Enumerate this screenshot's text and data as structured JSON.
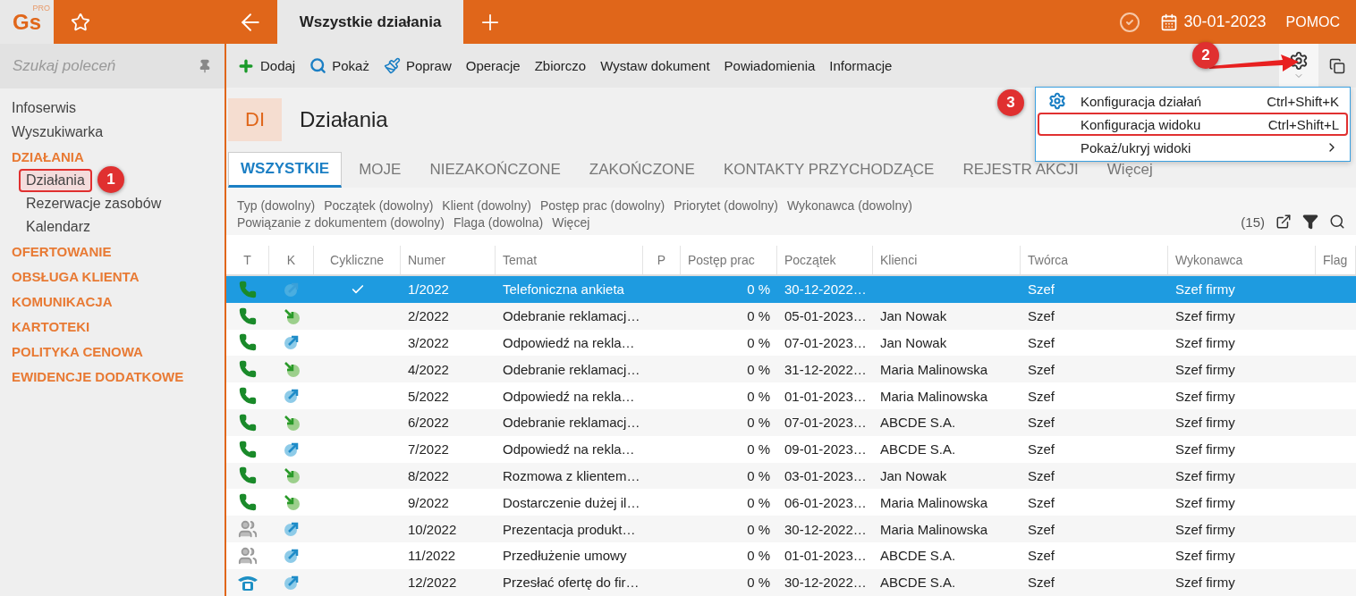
{
  "app": {
    "logo": "Gs",
    "logo_badge": "PRO",
    "tab": "Wszystkie działania",
    "date": "30-01-2023",
    "help": "POMOC"
  },
  "sidebar": {
    "search_placeholder": "Szukaj poleceń",
    "items": [
      {
        "label": "Infoserwis",
        "kind": "link"
      },
      {
        "label": "Wyszukiwarka",
        "kind": "link"
      },
      {
        "label": "DZIAŁANIA",
        "kind": "section",
        "children": [
          {
            "label": "Działania",
            "selected": true
          },
          {
            "label": "Rezerwacje zasobów",
            "selected": false
          },
          {
            "label": "Kalendarz",
            "selected": false
          }
        ]
      },
      {
        "label": "OFERTOWANIE",
        "kind": "section"
      },
      {
        "label": "OBSŁUGA KLIENTA",
        "kind": "section"
      },
      {
        "label": "KOMUNIKACJA",
        "kind": "section"
      },
      {
        "label": "KARTOTEKI",
        "kind": "section"
      },
      {
        "label": "POLITYKA CENOWA",
        "kind": "section"
      },
      {
        "label": "EWIDENCJE DODATKOWE",
        "kind": "section"
      }
    ]
  },
  "toolbar": [
    {
      "label": "Dodaj",
      "kind": "add"
    },
    {
      "label": "Pokaż",
      "kind": "search"
    },
    {
      "label": "Popraw",
      "kind": "edit"
    },
    {
      "label": "Operacje",
      "kind": "text"
    },
    {
      "label": "Zbiorczo",
      "kind": "text"
    },
    {
      "label": "Wystaw dokument",
      "kind": "text"
    },
    {
      "label": "Powiadomienia",
      "kind": "text"
    },
    {
      "label": "Informacje",
      "kind": "text"
    }
  ],
  "header": {
    "badge": "DI",
    "title": "Działania"
  },
  "view_tabs": [
    {
      "label": "WSZYSTKIE",
      "selected": true
    },
    {
      "label": "MOJE",
      "selected": false
    },
    {
      "label": "NIEZAKOŃCZONE",
      "selected": false
    },
    {
      "label": "ZAKOŃCZONE",
      "selected": false
    },
    {
      "label": "KONTAKTY PRZYCHODZĄCE",
      "selected": false
    },
    {
      "label": "REJESTR AKCJI",
      "selected": false
    },
    {
      "label": "Więcej",
      "selected": false
    }
  ],
  "filters": [
    "Typ (dowolny)",
    "Początek (dowolny)",
    "Klient (dowolny)",
    "Postęp prac (dowolny)",
    "Priorytet (dowolny)",
    "Wykonawca (dowolny)",
    "Powiązanie z dokumentem (dowolny)",
    "Flaga (dowolna)",
    "Więcej"
  ],
  "count": "(15)",
  "table": {
    "columns": [
      "T",
      "K",
      "Cykliczne",
      "Numer",
      "Temat",
      "P",
      "Postęp prac",
      "Początek",
      "Klienci",
      "Twórca",
      "Wykonawca",
      "Flag"
    ],
    "rows": [
      {
        "kind": "phone",
        "incoming": false,
        "cyclic": true,
        "selected": true,
        "number": "1/2022",
        "subject": "Telefoniczna ankieta",
        "progress": "0 %",
        "start": "30-12-2022…",
        "creator": "Szef",
        "assignee": "Szef firmy"
      },
      {
        "kind": "phone",
        "incoming": true,
        "cyclic": false,
        "selected": false,
        "number": "2/2022",
        "subject": "Odebranie reklamacj…",
        "progress": "0 %",
        "start": "05-01-2023…",
        "clients": "Jan Nowak",
        "creator": "Szef",
        "assignee": "Szef firmy"
      },
      {
        "kind": "phone",
        "incoming": false,
        "cyclic": false,
        "selected": false,
        "number": "3/2022",
        "subject": "Odpowiedź na rekla…",
        "progress": "0 %",
        "start": "07-01-2023…",
        "clients": "Jan Nowak",
        "creator": "Szef",
        "assignee": "Szef firmy"
      },
      {
        "kind": "phone",
        "incoming": true,
        "cyclic": false,
        "selected": false,
        "number": "4/2022",
        "subject": "Odebranie reklamacj…",
        "progress": "0 %",
        "start": "31-12-2022…",
        "clients": "Maria Malinowska",
        "creator": "Szef",
        "assignee": "Szef firmy"
      },
      {
        "kind": "phone",
        "incoming": false,
        "cyclic": false,
        "selected": false,
        "number": "5/2022",
        "subject": "Odpowiedź na rekla…",
        "progress": "0 %",
        "start": "01-01-2023…",
        "clients": "Maria Malinowska",
        "creator": "Szef",
        "assignee": "Szef firmy"
      },
      {
        "kind": "phone",
        "incoming": true,
        "cyclic": false,
        "selected": false,
        "number": "6/2022",
        "subject": "Odebranie reklamacj…",
        "progress": "0 %",
        "start": "07-01-2023…",
        "clients": "ABCDE S.A.",
        "creator": "Szef",
        "assignee": "Szef firmy"
      },
      {
        "kind": "phone",
        "incoming": false,
        "cyclic": false,
        "selected": false,
        "number": "7/2022",
        "subject": "Odpowiedź na rekla…",
        "progress": "0 %",
        "start": "09-01-2023…",
        "clients": "ABCDE S.A.",
        "creator": "Szef",
        "assignee": "Szef firmy"
      },
      {
        "kind": "phone",
        "incoming": true,
        "cyclic": false,
        "selected": false,
        "number": "8/2022",
        "subject": "Rozmowa z klientem…",
        "progress": "0 %",
        "start": "03-01-2023…",
        "clients": "Jan Nowak",
        "creator": "Szef",
        "assignee": "Szef firmy"
      },
      {
        "kind": "phone",
        "incoming": true,
        "cyclic": false,
        "selected": false,
        "number": "9/2022",
        "subject": "Dostarczenie dużej il…",
        "progress": "0 %",
        "start": "06-01-2023…",
        "clients": "Maria Malinowska",
        "creator": "Szef",
        "assignee": "Szef firmy"
      },
      {
        "kind": "meeting",
        "incoming": false,
        "cyclic": false,
        "selected": false,
        "number": "10/2022",
        "subject": "Prezentacja produkt…",
        "progress": "0 %",
        "start": "30-12-2022…",
        "clients": "Maria Malinowska",
        "creator": "Szef",
        "assignee": "Szef firmy"
      },
      {
        "kind": "meeting",
        "incoming": false,
        "cyclic": false,
        "selected": false,
        "number": "11/2022",
        "subject": "Przedłużenie umowy",
        "progress": "0 %",
        "start": "01-01-2023…",
        "clients": "ABCDE S.A.",
        "creator": "Szef",
        "assignee": "Szef firmy"
      },
      {
        "kind": "deskphone",
        "incoming": false,
        "cyclic": false,
        "selected": false,
        "number": "12/2022",
        "subject": "Przesłać ofertę do fir…",
        "progress": "0 %",
        "start": "30-12-2022…",
        "clients": "ABCDE S.A.",
        "creator": "Szef",
        "assignee": "Szef firmy"
      }
    ]
  },
  "menu": {
    "items": [
      {
        "label": "Konfiguracja działań",
        "shortcut": "Ctrl+Shift+K",
        "kind": "settings",
        "highlighted": false
      },
      {
        "label": "Konfiguracja widoku",
        "shortcut": "Ctrl+Shift+L",
        "kind": "plain",
        "highlighted": true
      },
      {
        "label": "Pokaż/ukryj widoki",
        "submenu": true,
        "kind": "plain",
        "highlighted": false
      }
    ]
  },
  "annotations": [
    {
      "label": "1"
    },
    {
      "label": "2"
    },
    {
      "label": "3"
    }
  ]
}
